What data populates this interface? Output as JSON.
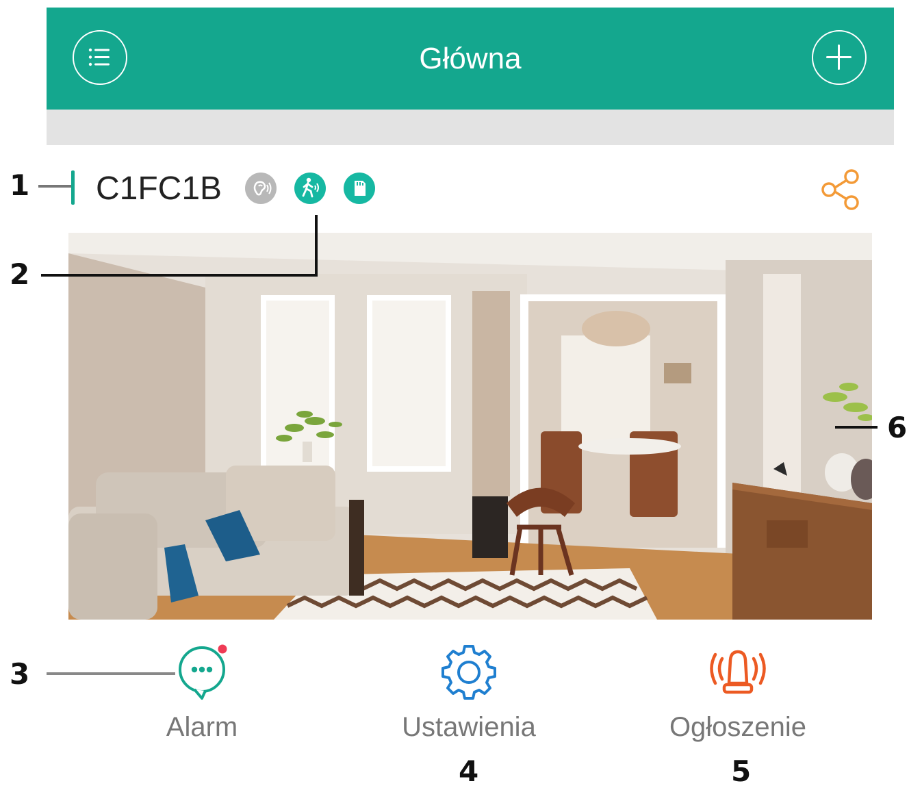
{
  "header": {
    "title": "Główna",
    "background_color": "#14a78e",
    "menu_icon": "menu-icon",
    "add_icon": "plus-icon"
  },
  "device": {
    "name": "C1FC1B",
    "online_color": "#14a78e",
    "status_icons": [
      {
        "name": "sound-detection-icon",
        "active": false
      },
      {
        "name": "motion-detection-icon",
        "active": true
      },
      {
        "name": "sd-card-icon",
        "active": true
      }
    ],
    "share_icon": "share-icon",
    "share_color": "#f39a37"
  },
  "actions": [
    {
      "label": "Alarm",
      "icon": "alarm-message-icon",
      "color": "#14a78e",
      "badge": true
    },
    {
      "label": "Ustawienia",
      "icon": "gear-icon",
      "color": "#1f7fd0"
    },
    {
      "label": "Ogłoszenie",
      "icon": "siren-icon",
      "color": "#ec5a23"
    }
  ],
  "callouts": [
    "1",
    "2",
    "3",
    "4",
    "5",
    "6"
  ]
}
